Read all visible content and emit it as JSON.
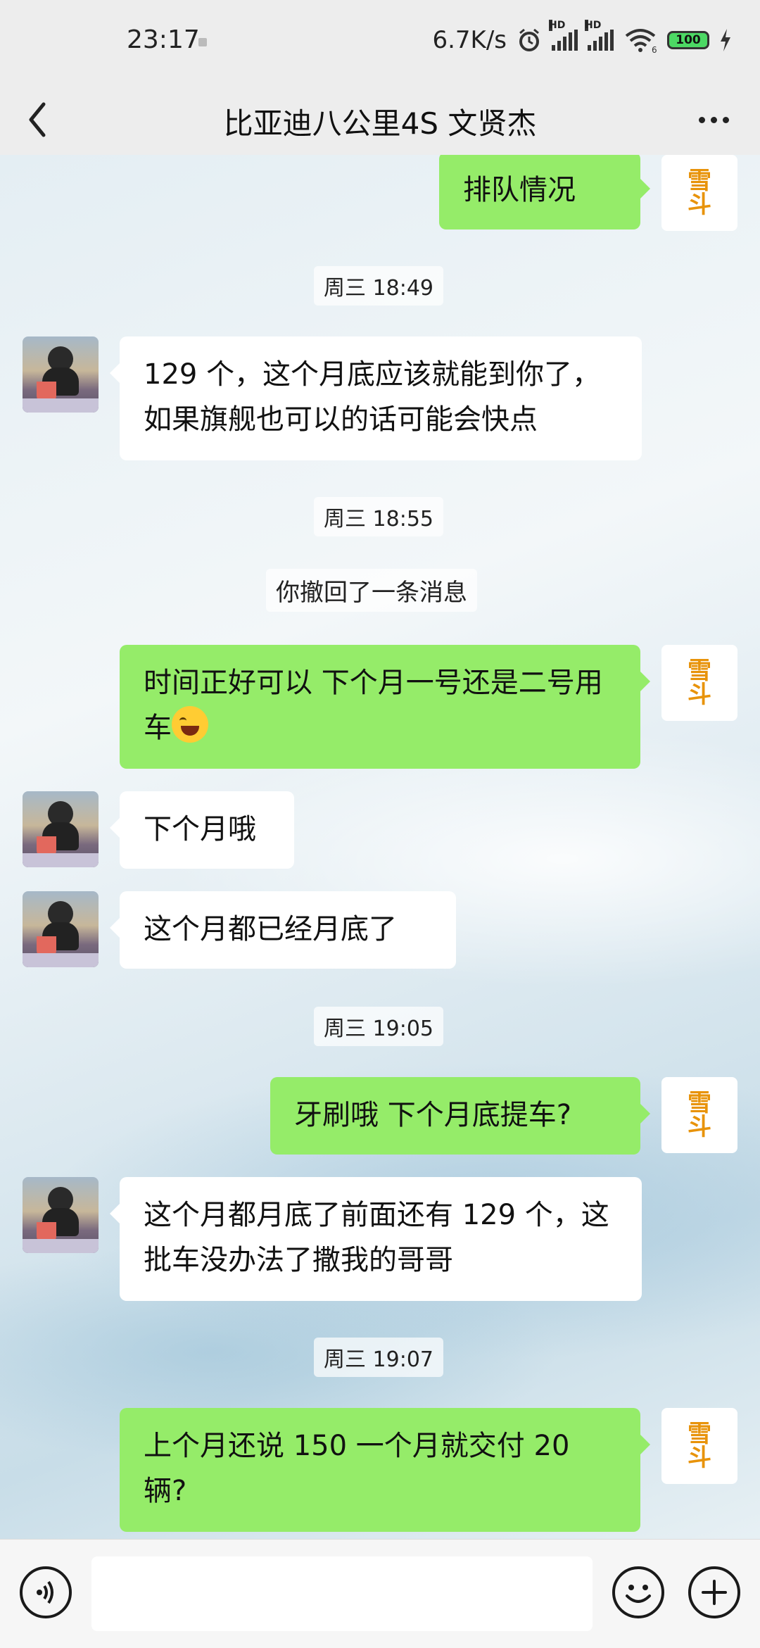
{
  "status_bar": {
    "time": "23:17",
    "speed": "6.7K/s",
    "signal_label_1": "HD",
    "signal_label_2": "HD",
    "wifi_label": "6",
    "battery": "100"
  },
  "header": {
    "title": "比亚迪八公里4S 文贤杰"
  },
  "messages": [
    {
      "type": "out",
      "text": "排队情况"
    },
    {
      "type": "time",
      "text": "周三 18:49"
    },
    {
      "type": "in",
      "text": "129 个，这个月底应该就能到你了，如果旗舰也可以的话可能会快点"
    },
    {
      "type": "time",
      "text": "周三 18:55"
    },
    {
      "type": "system",
      "text": "你撤回了一条消息"
    },
    {
      "type": "out",
      "text": "时间正好可以   下个月一号还是二号用车"
    },
    {
      "type": "in",
      "text": "下个月哦"
    },
    {
      "type": "in",
      "text": "这个月都已经月底了"
    },
    {
      "type": "time",
      "text": "周三 19:05"
    },
    {
      "type": "out",
      "text": "牙刷哦  下个月底提车?"
    },
    {
      "type": "in",
      "text": "这个月都月底了前面还有 129 个，这批车没办法了撒我的哥哥"
    },
    {
      "type": "time",
      "text": "周三 19:07"
    },
    {
      "type": "out",
      "text": "上个月还说 150  一个月就交付 20 辆?"
    }
  ],
  "self_avatar": {
    "label_1": "雪",
    "label_2": "斗"
  },
  "icons": {
    "back": "chevron-left-icon",
    "more": "more-dots-icon",
    "voice": "voice-icon",
    "emoji": "emoji-icon",
    "plus": "plus-icon",
    "inline_emoji": "tears-of-joy-emoji"
  },
  "colors": {
    "out_bubble": "#95ec69",
    "in_bubble": "#ffffff",
    "bar_bg": "#ededed"
  },
  "input": {
    "value": "",
    "placeholder": ""
  }
}
